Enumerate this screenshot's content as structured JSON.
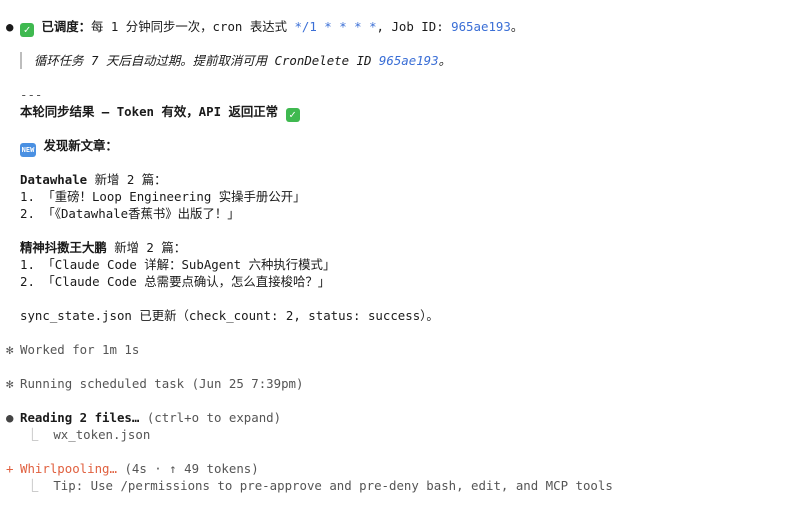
{
  "scheduled": {
    "bullet": "●",
    "title": "已调度：",
    "text1": "每 1 分钟同步一次，cron 表达式 ",
    "cron": "*/1 * * * *",
    "text2": ", Job ID: ",
    "job_id": "965ae193",
    "text3": "。"
  },
  "note": {
    "text": "循环任务 7 天后自动过期。提前取消可用 CronDelete ID ",
    "job_id": "965ae193",
    "end": "。"
  },
  "separator": "---",
  "result": {
    "text": "本轮同步结果 — Token 有效，API 返回正常 "
  },
  "new_articles": {
    "badge": "NEW",
    "label": "发现新文章："
  },
  "groups": [
    {
      "source": "Datawhale",
      "count_text": " 新增 2 篇：",
      "items": [
        "1. 「重磅！Loop Engineering 实操手册公开」",
        "2. 「《Datawhale香蕉书》出版了！」"
      ]
    },
    {
      "source": "精神抖擞王大鹏",
      "count_text": " 新增 2 篇：",
      "items": [
        "1. 「Claude Code 详解：SubAgent 六种执行模式」",
        "2. 「Claude Code 总需要点确认，怎么直接梭哈？」"
      ]
    }
  ],
  "sync_state": "sync_state.json 已更新（check_count: 2, status: success）。",
  "worked": {
    "marker": "✻",
    "text": "Worked for 1m 1s"
  },
  "running": {
    "marker": "✻",
    "text": "Running scheduled task (Jun 25 7:39pm)"
  },
  "reading": {
    "bullet": "●",
    "label": "Reading 2 files…",
    "hint": " (ctrl+o to expand)",
    "elbow": "⎿",
    "file": "wx_token.json"
  },
  "status": {
    "marker": "+",
    "label": "Whirlpooling…",
    "meta": " (4s · ↑ 49 tokens)",
    "elbow": "⎿",
    "tip": "Tip: Use /permissions to pre-approve and pre-deny bash, edit, and MCP tools"
  },
  "colors": {
    "link_blue": "#3b6fd6",
    "accent_orange": "#e0603f",
    "check_green": "#3fb950",
    "new_badge_blue": "#4a90e2"
  },
  "icons": [
    "check-icon",
    "new-badge-icon"
  ]
}
